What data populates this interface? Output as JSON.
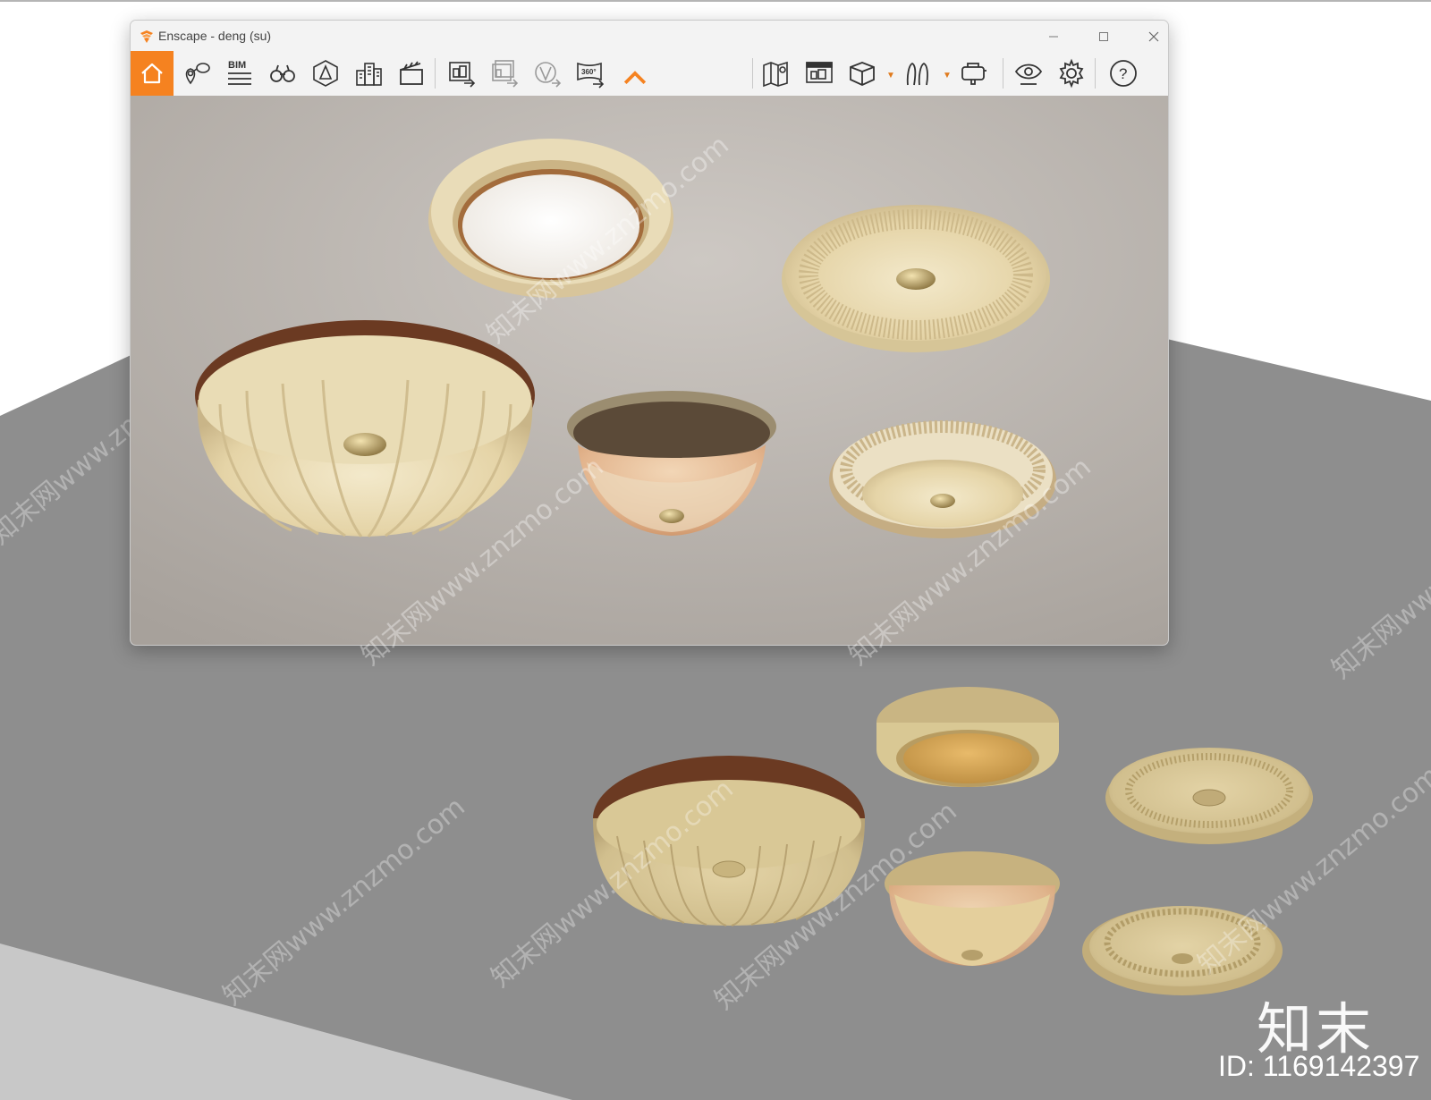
{
  "window": {
    "title": "Enscape - deng (su)",
    "controls": {
      "minimize": "minimize",
      "maximize": "maximize",
      "close": "close"
    }
  },
  "toolbar": {
    "items": [
      {
        "name": "home",
        "icon": "home-icon"
      },
      {
        "name": "views",
        "icon": "location-pin-icon"
      },
      {
        "name": "bim",
        "icon": "bim-icon",
        "label": "BIM"
      },
      {
        "name": "explore",
        "icon": "binoculars-icon"
      },
      {
        "name": "assets",
        "icon": "asset-library-icon"
      },
      {
        "name": "buildings",
        "icon": "buildings-icon"
      },
      {
        "name": "video",
        "icon": "clapper-icon"
      },
      {
        "name": "export-image",
        "icon": "export-image-icon"
      },
      {
        "name": "batch-export",
        "icon": "batch-export-icon"
      },
      {
        "name": "web-standalone",
        "icon": "web-export-icon"
      },
      {
        "name": "export-360",
        "icon": "panorama-export-icon",
        "label": "360°"
      },
      {
        "name": "collapse",
        "icon": "chevron-up-icon"
      },
      {
        "name": "map",
        "icon": "map-icon"
      },
      {
        "name": "site-context",
        "icon": "site-context-icon"
      },
      {
        "name": "object-mode",
        "icon": "cube-icon"
      },
      {
        "name": "walk-mode",
        "icon": "footprints-icon"
      },
      {
        "name": "vr",
        "icon": "vr-headset-icon"
      },
      {
        "name": "visual-settings",
        "icon": "eye-icon"
      },
      {
        "name": "settings",
        "icon": "gear-icon"
      },
      {
        "name": "help",
        "icon": "help-icon",
        "label": "?"
      }
    ]
  },
  "watermark": {
    "text": "知末网www.znzmo.com",
    "brand": "知末",
    "id_label": "ID: 1169142397"
  },
  "colors": {
    "accent": "#f58220",
    "floor": "#8e8e8e",
    "lamp_cream": "#e6d6ae",
    "lamp_wood": "#6b3a22"
  }
}
